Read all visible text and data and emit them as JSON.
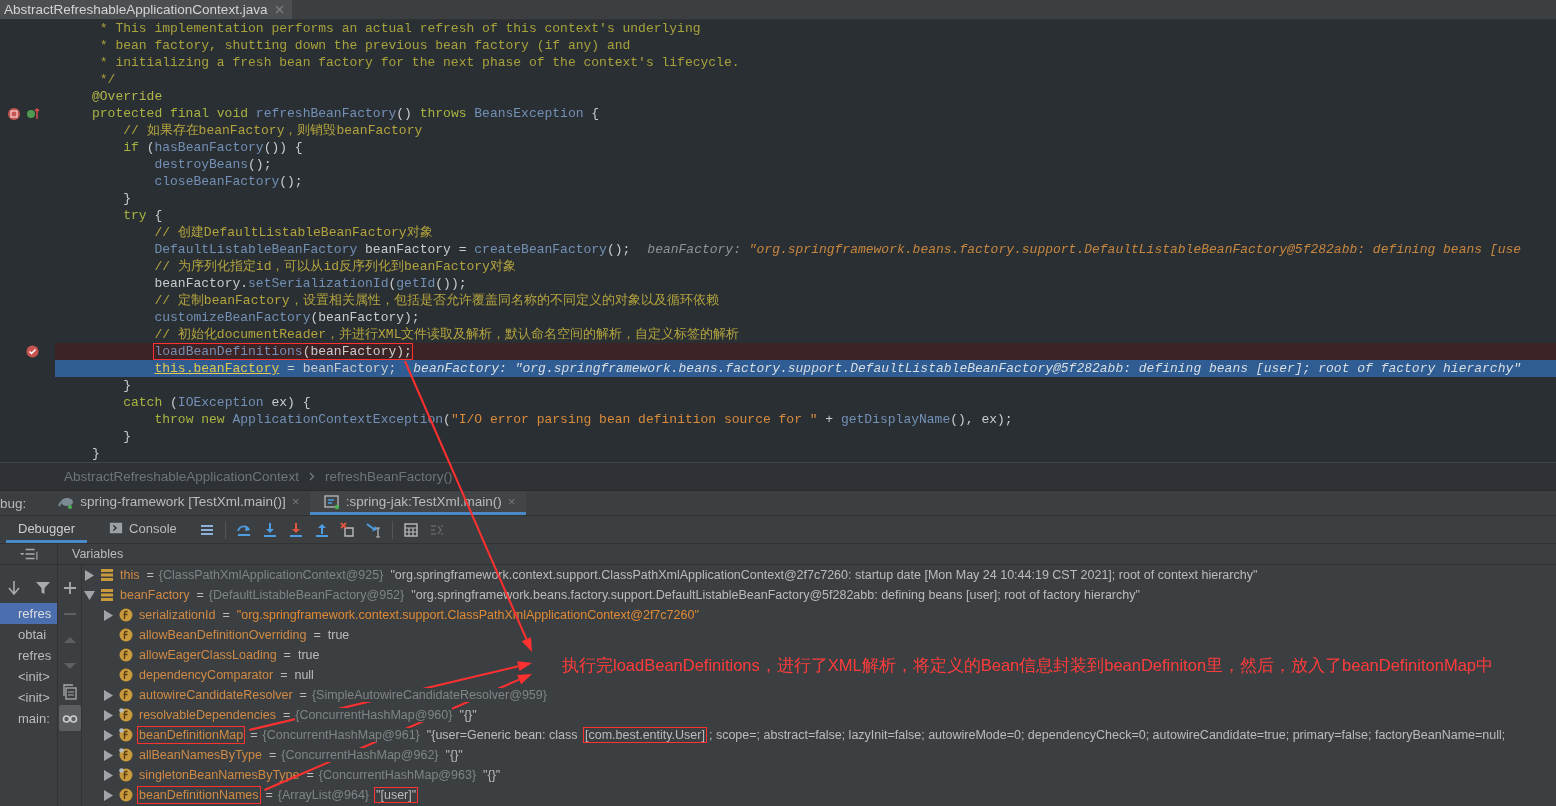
{
  "editor_tab": {
    "title": "AbstractRefreshableApplicationContext.java",
    "selected": true
  },
  "code_lines": [
    {
      "breakpoint": false,
      "current": false,
      "boxed": false,
      "tokens": [
        {
          "kind": "doc",
          "text": " * This implementation performs an actual refresh of this context's underlying"
        }
      ]
    },
    {
      "breakpoint": false,
      "current": false,
      "boxed": false,
      "tokens": [
        {
          "kind": "doc",
          "text": " * bean factory, shutting down the previous bean factory (if any) and"
        }
      ]
    },
    {
      "breakpoint": false,
      "current": false,
      "boxed": false,
      "tokens": [
        {
          "kind": "doc",
          "text": " * initializing a fresh bean factory for the next phase of the context's lifecycle."
        }
      ]
    },
    {
      "breakpoint": false,
      "current": false,
      "boxed": false,
      "tokens": [
        {
          "kind": "doc",
          "text": " */"
        }
      ]
    },
    {
      "breakpoint": false,
      "current": false,
      "boxed": false,
      "tokens": [
        {
          "kind": "annotation",
          "text": "@Override"
        }
      ]
    },
    {
      "breakpoint": false,
      "current": false,
      "boxed": false,
      "method_breakpoint": true,
      "overrides": true,
      "tokens": [
        {
          "kind": "keyword",
          "text": "protected final void "
        },
        {
          "kind": "method",
          "text": "refreshBeanFactory"
        },
        {
          "kind": "plain",
          "text": "() "
        },
        {
          "kind": "keyword",
          "text": "throws "
        },
        {
          "kind": "type",
          "text": "BeansException"
        },
        {
          "kind": "plain",
          "text": " {"
        }
      ]
    },
    {
      "breakpoint": false,
      "current": false,
      "boxed": false,
      "tokens": [
        {
          "kind": "comment",
          "text": "    // 如果存在beanFactory，则销毁beanFactory"
        }
      ]
    },
    {
      "breakpoint": false,
      "current": false,
      "boxed": false,
      "tokens": [
        {
          "kind": "keyword",
          "text": "    if "
        },
        {
          "kind": "plain",
          "text": "("
        },
        {
          "kind": "method",
          "text": "hasBeanFactory"
        },
        {
          "kind": "plain",
          "text": "()) {"
        }
      ]
    },
    {
      "breakpoint": false,
      "current": false,
      "boxed": false,
      "tokens": [
        {
          "kind": "method",
          "text": "        destroyBeans"
        },
        {
          "kind": "plain",
          "text": "();"
        }
      ]
    },
    {
      "breakpoint": false,
      "current": false,
      "boxed": false,
      "tokens": [
        {
          "kind": "method",
          "text": "        closeBeanFactory"
        },
        {
          "kind": "plain",
          "text": "();"
        }
      ]
    },
    {
      "breakpoint": false,
      "current": false,
      "boxed": false,
      "tokens": [
        {
          "kind": "plain",
          "text": "    }"
        }
      ]
    },
    {
      "breakpoint": false,
      "current": false,
      "boxed": false,
      "tokens": [
        {
          "kind": "keyword",
          "text": "    try "
        },
        {
          "kind": "plain",
          "text": "{"
        }
      ]
    },
    {
      "breakpoint": false,
      "current": false,
      "boxed": false,
      "tokens": [
        {
          "kind": "comment",
          "text": "        // 创建DefaultListableBeanFactory对象"
        }
      ]
    },
    {
      "breakpoint": false,
      "current": false,
      "boxed": false,
      "tokens": [
        {
          "kind": "type",
          "text": "        DefaultListableBeanFactory"
        },
        {
          "kind": "plain",
          "text": " beanFactory = "
        },
        {
          "kind": "method",
          "text": "createBeanFactory"
        },
        {
          "kind": "plain",
          "text": "();"
        }
      ],
      "hint": [
        {
          "kind": "hint-label",
          "text": "beanFactory: "
        },
        {
          "kind": "hint-value",
          "text": "\"org.springframework.beans.factory.support.DefaultListableBeanFactory@5f282abb: defining beans [use"
        }
      ]
    },
    {
      "breakpoint": false,
      "current": false,
      "boxed": false,
      "tokens": [
        {
          "kind": "comment",
          "text": "        // 为序列化指定id，可以从id反序列化到beanFactory对象"
        }
      ]
    },
    {
      "breakpoint": false,
      "current": false,
      "boxed": false,
      "tokens": [
        {
          "kind": "plain",
          "text": "        beanFactory."
        },
        {
          "kind": "method",
          "text": "setSerializationId"
        },
        {
          "kind": "plain",
          "text": "("
        },
        {
          "kind": "method",
          "text": "getId"
        },
        {
          "kind": "plain",
          "text": "());"
        }
      ]
    },
    {
      "breakpoint": false,
      "current": false,
      "boxed": false,
      "tokens": [
        {
          "kind": "comment",
          "text": "        // 定制beanFactory，设置相关属性，包括是否允许覆盖同名称的不同定义的对象以及循环依赖"
        }
      ]
    },
    {
      "breakpoint": false,
      "current": false,
      "boxed": false,
      "tokens": [
        {
          "kind": "method",
          "text": "        customizeBeanFactory"
        },
        {
          "kind": "plain",
          "text": "(beanFactory);"
        }
      ]
    },
    {
      "breakpoint": false,
      "current": false,
      "boxed": false,
      "tokens": [
        {
          "kind": "comment",
          "text": "        // 初始化documentReader，并进行XML文件读取及解析，默认命名空间的解析，自定义标签的解析"
        }
      ]
    },
    {
      "breakpoint": true,
      "current": false,
      "boxed": true,
      "tokens": [
        {
          "kind": "method",
          "text": "        loadBeanDefinitions"
        },
        {
          "kind": "plain",
          "text": "(beanFactory);"
        }
      ]
    },
    {
      "breakpoint": false,
      "current": true,
      "boxed": false,
      "tokens": [
        {
          "kind": "field",
          "text": "        this.beanFactory"
        },
        {
          "kind": "plain",
          "text": " = beanFactory;"
        }
      ],
      "hint": [
        {
          "kind": "hint-label",
          "text": "beanFactory: "
        },
        {
          "kind": "hint-value",
          "text": "\"org.springframework.beans.factory.support.DefaultListableBeanFactory@5f282abb: defining beans [user]; root of factory hierarchy\""
        }
      ]
    },
    {
      "breakpoint": false,
      "current": false,
      "boxed": false,
      "tokens": [
        {
          "kind": "plain",
          "text": "    }"
        }
      ]
    },
    {
      "breakpoint": false,
      "current": false,
      "boxed": false,
      "tokens": [
        {
          "kind": "keyword",
          "text": "    catch "
        },
        {
          "kind": "plain",
          "text": "("
        },
        {
          "kind": "type",
          "text": "IOException"
        },
        {
          "kind": "plain",
          "text": " ex) {"
        }
      ]
    },
    {
      "breakpoint": false,
      "current": false,
      "boxed": false,
      "tokens": [
        {
          "kind": "keyword",
          "text": "        throw new "
        },
        {
          "kind": "type",
          "text": "ApplicationContextException"
        },
        {
          "kind": "plain",
          "text": "("
        },
        {
          "kind": "string",
          "text": "\"I/O error parsing bean definition source for \""
        },
        {
          "kind": "plain",
          "text": " + "
        },
        {
          "kind": "method",
          "text": "getDisplayName"
        },
        {
          "kind": "plain",
          "text": "(), ex);"
        }
      ]
    },
    {
      "breakpoint": false,
      "current": false,
      "boxed": false,
      "tokens": [
        {
          "kind": "plain",
          "text": "    }"
        }
      ]
    },
    {
      "breakpoint": false,
      "current": false,
      "boxed": false,
      "tokens": [
        {
          "kind": "plain",
          "text": "}"
        }
      ]
    }
  ],
  "breadcrumb": [
    "AbstractRefreshableApplicationContext",
    "refreshBeanFactory()"
  ],
  "debug": {
    "label": "bug:",
    "sessions": [
      {
        "label": "spring-framework [TestXml.main()]",
        "close": "×",
        "selected": false
      },
      {
        "label": ":spring-jak:TestXml.main()",
        "close": "×",
        "selected": true
      }
    ],
    "views": [
      {
        "label": "Debugger",
        "selected": true
      },
      {
        "label": "Console",
        "selected": false
      }
    ],
    "variables_title": "Variables",
    "frames": [
      {
        "label": "refres",
        "selected": true
      },
      {
        "label": "obtai",
        "selected": false
      },
      {
        "label": "refres",
        "selected": false
      },
      {
        "label": "<init>",
        "selected": false
      },
      {
        "label": "<init>",
        "selected": false
      },
      {
        "label": "main:",
        "selected": false
      }
    ],
    "variables": [
      {
        "kind": "object",
        "name": "this",
        "name_boxed": false,
        "operator": "=",
        "type": "{ClassPathXmlApplicationContext@925}",
        "value": [
          {
            "text": "\"org.springframework.context.support.ClassPathXmlApplicationContext@2f7c7260: startup date [Mon May 24 10:44:19 CST 2021]; root of context hierarchy\"",
            "boxed": false
          }
        ],
        "expanded": false
      },
      {
        "kind": "object",
        "name": "beanFactory",
        "name_boxed": false,
        "operator": "=",
        "type": "{DefaultListableBeanFactory@952}",
        "value": [
          {
            "text": "\"org.springframework.beans.factory.support.DefaultListableBeanFactory@5f282abb: defining beans [user]; root of factory hierarchy\"",
            "boxed": false
          }
        ],
        "expanded": true,
        "children": [
          {
            "kind": "string-field",
            "name": "serializationId",
            "name_boxed": false,
            "operator": "=",
            "value": [
              {
                "text": "\"org.springframework.context.support.ClassPathXmlApplicationContext@2f7c7260\"",
                "boxed": false
              }
            ],
            "expanded": false
          },
          {
            "kind": "field",
            "name": "allowBeanDefinitionOverriding",
            "name_boxed": false,
            "operator": "=",
            "value": [
              {
                "text": "true",
                "boxed": false
              }
            ]
          },
          {
            "kind": "field",
            "name": "allowEagerClassLoading",
            "name_boxed": false,
            "operator": "=",
            "value": [
              {
                "text": "true",
                "boxed": false
              }
            ]
          },
          {
            "kind": "field",
            "name": "dependencyComparator",
            "name_boxed": false,
            "operator": "=",
            "value": [
              {
                "text": "null",
                "boxed": false
              }
            ]
          },
          {
            "kind": "field",
            "name": "autowireCandidateResolver",
            "name_boxed": false,
            "operator": "=",
            "type": "{SimpleAutowireCandidateResolver@959}",
            "expanded": false
          },
          {
            "kind": "final-field",
            "name": "resolvableDependencies",
            "name_boxed": false,
            "operator": "=",
            "type": "{ConcurrentHashMap@960}",
            "value": [
              {
                "text": "\"{}\"",
                "boxed": false
              }
            ],
            "expanded": false
          },
          {
            "kind": "final-field",
            "name": "beanDefinitionMap",
            "name_boxed": true,
            "operator": "=",
            "type": "{ConcurrentHashMap@961}",
            "value": [
              {
                "text": "\"{user=Generic bean: class ",
                "boxed": false
              },
              {
                "text": "[com.best.entity.User]",
                "boxed": true
              },
              {
                "text": "; scope=; abstract=false; lazyInit=false; autowireMode=0; dependencyCheck=0; autowireCandidate=true; primary=false; factoryBeanName=null;",
                "boxed": false
              }
            ],
            "expanded": false
          },
          {
            "kind": "final-field",
            "name": "allBeanNamesByType",
            "name_boxed": false,
            "operator": "=",
            "type": "{ConcurrentHashMap@962}",
            "value": [
              {
                "text": "\"{}\"",
                "boxed": false
              }
            ],
            "expanded": false
          },
          {
            "kind": "final-field",
            "name": "singletonBeanNamesByType",
            "name_boxed": false,
            "operator": "=",
            "type": "{ConcurrentHashMap@963}",
            "value": [
              {
                "text": "\"{}\"",
                "boxed": false
              }
            ],
            "expanded": false
          },
          {
            "kind": "field",
            "name": "beanDefinitionNames",
            "name_boxed": true,
            "operator": "=",
            "type": "{ArrayList@964}",
            "value": [
              {
                "text": "\"[user]\"",
                "boxed": true
              }
            ],
            "expanded": false
          }
        ]
      }
    ]
  },
  "annotation": {
    "text": "执行完loadBeanDefinitions，进行了XML解析，将定义的Bean信息封装到beanDefiniton里，然后，放入了beanDefinitonMap中"
  }
}
